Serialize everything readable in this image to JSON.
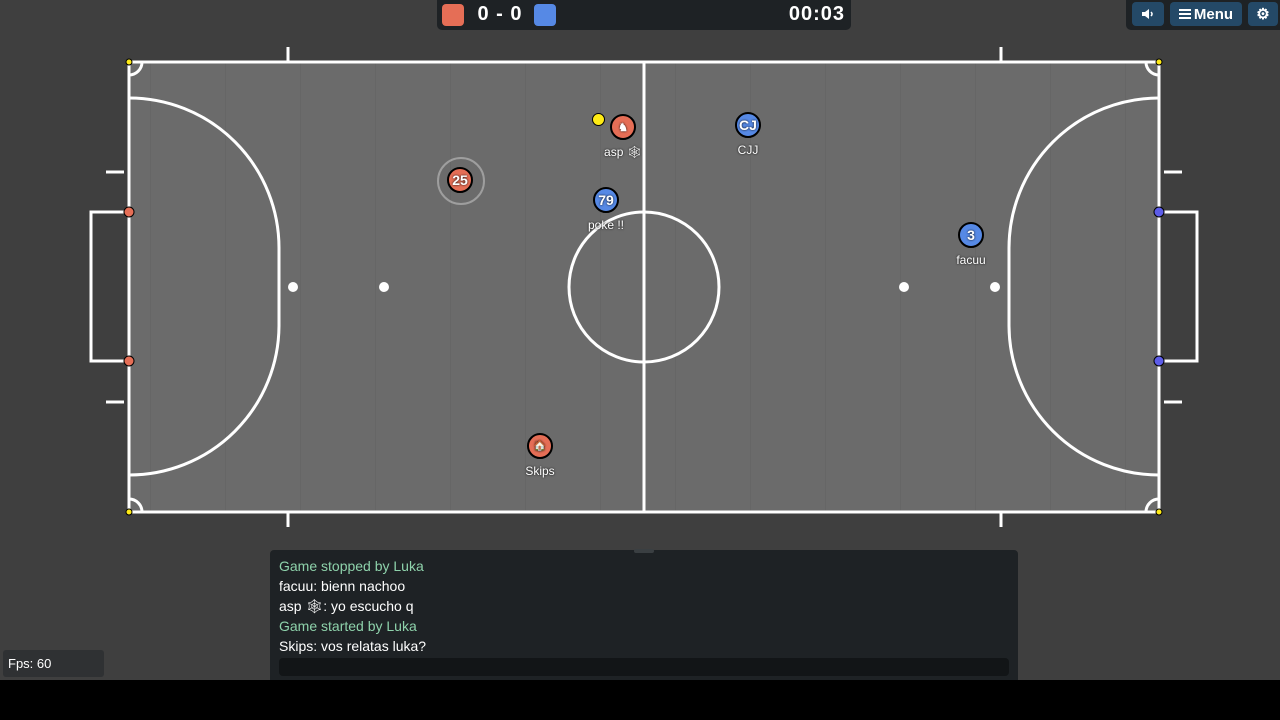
{
  "scoreboard": {
    "score": "0 - 0",
    "time": "00:03",
    "red_color": "#e56e56",
    "blue_color": "#5689e5"
  },
  "buttons": {
    "sound_icon": "speaker-icon",
    "menu_label": "Menu",
    "settings_icon": "gear-icon"
  },
  "players": [
    {
      "name": "asp 🕸",
      "team": "red",
      "avatar": "♞"
    },
    {
      "name": "CJJ",
      "team": "blue",
      "avatar": "CJ"
    },
    {
      "name": "",
      "team": "red",
      "avatar": "25"
    },
    {
      "name": "poke !!",
      "team": "blue",
      "avatar": "79"
    },
    {
      "name": "facuu",
      "team": "blue",
      "avatar": "3"
    },
    {
      "name": "Skips",
      "team": "red",
      "avatar": "🏠"
    }
  ],
  "chat": {
    "messages": [
      {
        "text": "Game stopped by Luka",
        "type": "notice"
      },
      {
        "text": "facuu: bienn nachoo",
        "type": "chat"
      },
      {
        "text": "asp 🕸: yo escucho q",
        "type": "chat"
      },
      {
        "text": "Game started by Luka",
        "type": "notice"
      },
      {
        "text": "Skips: vos relatas luka?",
        "type": "chat"
      }
    ],
    "input_value": ""
  },
  "fps": "Fps: 60",
  "colors": {
    "red_team": "#e56e56",
    "blue_team": "#5689e5",
    "ball": "#ffeb15",
    "field": "#6b6b6b",
    "notice_text": "#8ed2ab"
  }
}
